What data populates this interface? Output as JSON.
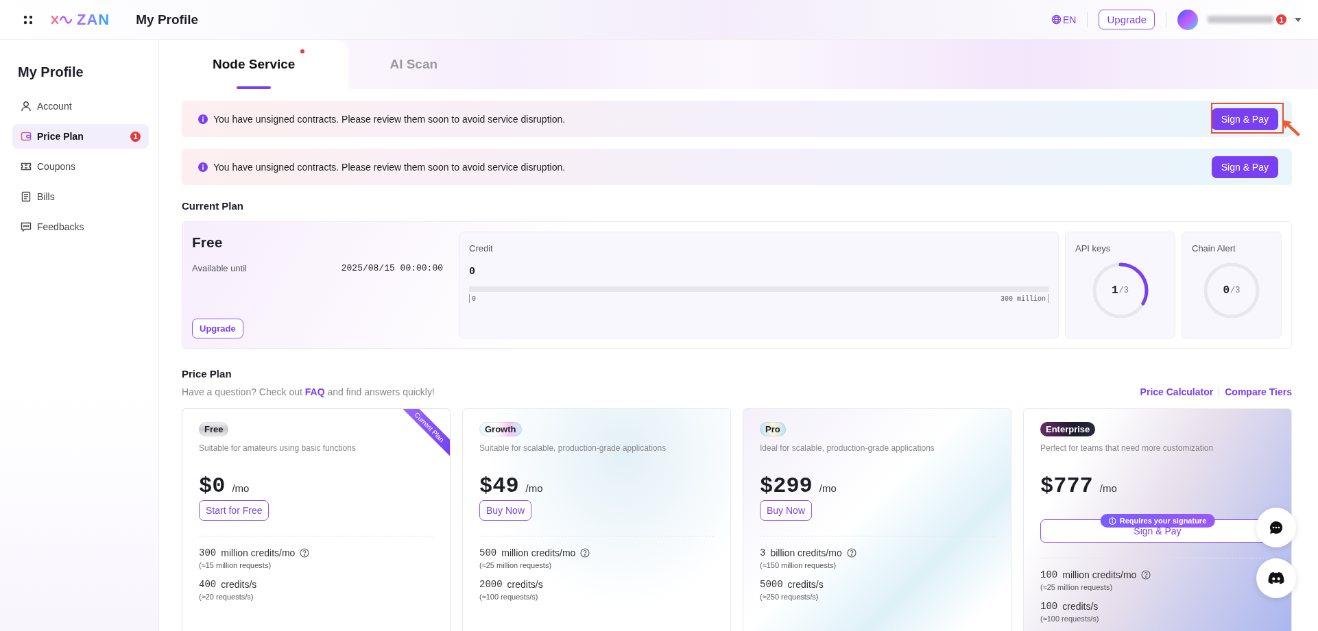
{
  "header": {
    "logo": "ZAN",
    "title": "My Profile",
    "language": "EN",
    "upgrade": "Upgrade",
    "notifications": "1"
  },
  "sidebar": {
    "title": "My Profile",
    "items": [
      {
        "label": "Account",
        "kind": "person",
        "selected": false
      },
      {
        "label": "Price Plan",
        "kind": "wallet",
        "selected": true,
        "badge": "1"
      },
      {
        "label": "Coupons",
        "kind": "ticket",
        "selected": false
      },
      {
        "label": "Bills",
        "kind": "document",
        "selected": false
      },
      {
        "label": "Feedbacks",
        "kind": "chat",
        "selected": false
      }
    ]
  },
  "tabs": [
    {
      "label": "Node Service",
      "selected": true,
      "dot": true
    },
    {
      "label": "AI Scan",
      "selected": false,
      "dot": false
    }
  ],
  "alerts": [
    {
      "message": "You have unsigned contracts. Please review them soon to avoid service disruption.",
      "action": "Sign & Pay",
      "highlighted": true
    },
    {
      "message": "You have unsigned contracts. Please review them soon to avoid service disruption.",
      "action": "Sign & Pay",
      "highlighted": false
    }
  ],
  "current_plan": {
    "heading": "Current Plan",
    "plan": "Free",
    "until_label": "Available until",
    "until_value": "2025/08/15 00:00:00",
    "upgrade": "Upgrade",
    "credit": {
      "label": "Credit",
      "value": "0",
      "level": 0,
      "min_label": "0",
      "max_label": "300 million"
    },
    "gauges": [
      {
        "label": "API keys",
        "used": "1",
        "total": "/3",
        "level": 0.333
      },
      {
        "label": "Chain Alert",
        "used": "0",
        "total": "/3",
        "level": 0
      }
    ]
  },
  "price_plan": {
    "heading": "Price Plan",
    "question": "Have a question? Check out",
    "faq": "FAQ",
    "answer": "and find answers quickly!",
    "links": [
      "Price Calculator",
      "Compare Tiers"
    ],
    "plans": [
      {
        "tag": "Free",
        "kind": "silver",
        "description": "Suitable for amateurs using basic functions",
        "price": "$0",
        "period": "/mo",
        "action": "Start for Free",
        "current": true,
        "ribbon": "Current Plan",
        "features": [
          {
            "amount": "300",
            "unit": "million credits/mo",
            "help": true,
            "note": "(≈15 million requests)"
          },
          {
            "amount": "400",
            "unit": "credits/s",
            "help": false,
            "note": "(≈20 requests/s)"
          }
        ]
      },
      {
        "tag": "Growth",
        "kind": "pearl",
        "description": "Suitable for scalable, production-grade applications",
        "price": "$49",
        "period": "/mo",
        "action": "Buy Now",
        "current": false,
        "features": [
          {
            "amount": "500",
            "unit": "million credits/mo",
            "help": true,
            "note": "(≈25 million requests)"
          },
          {
            "amount": "2000",
            "unit": "credits/s",
            "help": false,
            "note": "(≈100 requests/s)"
          }
        ]
      },
      {
        "tag": "Pro",
        "kind": "opal",
        "description": "Ideal for scalable, production-grade applications",
        "price": "$299",
        "period": "/mo",
        "action": "Buy Now",
        "current": false,
        "features": [
          {
            "amount": "3",
            "unit": "billion credits/mo",
            "help": true,
            "note": "(≈150 million requests)"
          },
          {
            "amount": "5000",
            "unit": "credits/s",
            "help": false,
            "note": "(≈250 requests/s)"
          }
        ]
      },
      {
        "tag": "Enterprise",
        "kind": "dark",
        "description": "Perfect for teams that need more customization",
        "price": "$777",
        "period": "/mo",
        "action": "Sign & Pay",
        "notice": "Requires your signature",
        "current": false,
        "features": [
          {
            "amount": "100",
            "unit": "million credits/mo",
            "help": true,
            "note": "(≈25 million requests)"
          },
          {
            "amount": "100",
            "unit": "credits/s",
            "help": false,
            "note": "(≈100 requests/s)"
          }
        ]
      }
    ]
  },
  "floating_buttons": [
    {
      "kind": "chat"
    },
    {
      "kind": "discord"
    }
  ]
}
